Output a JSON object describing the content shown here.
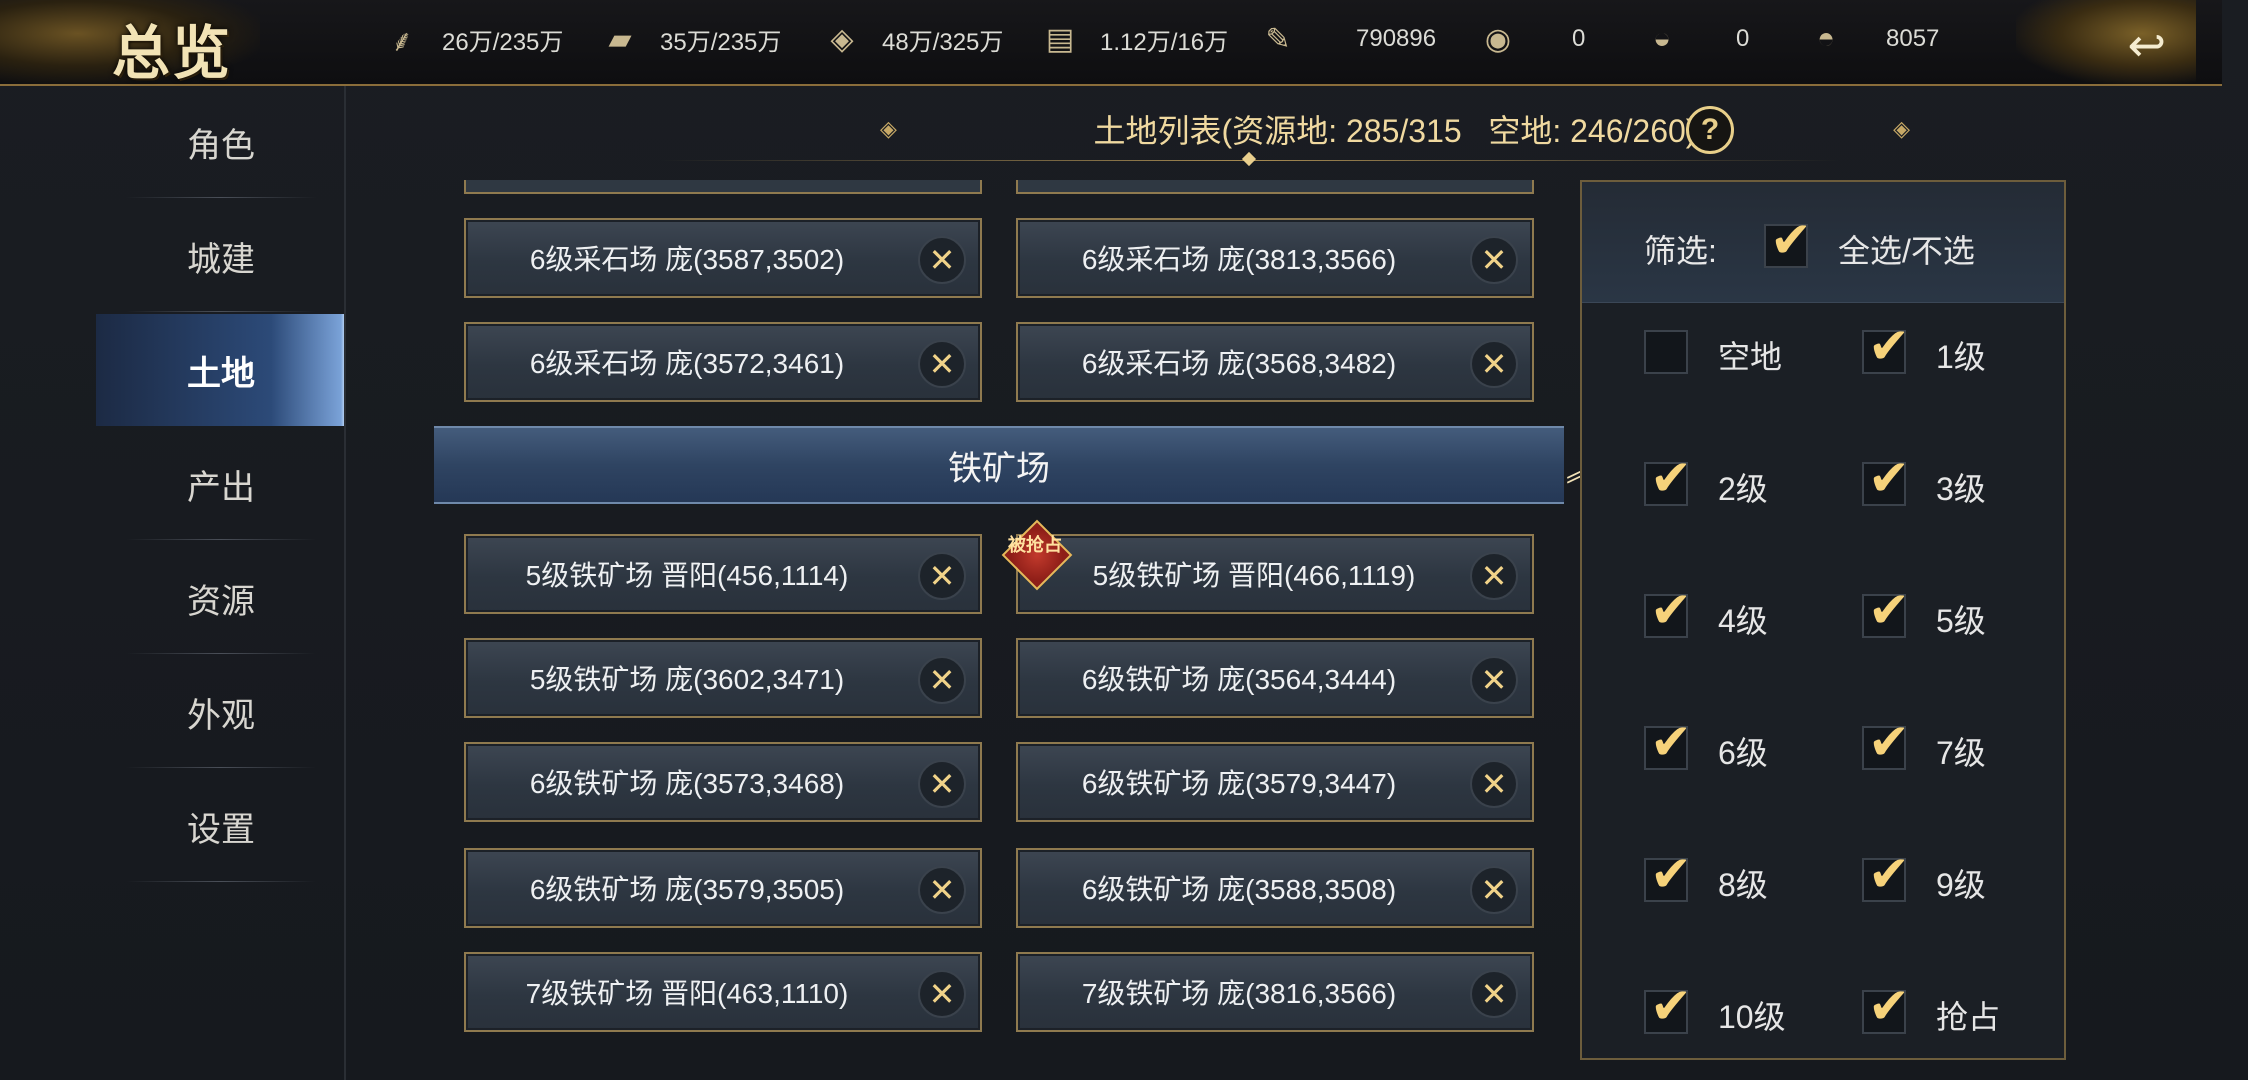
{
  "header": {
    "title": "总览",
    "resources": [
      {
        "icon": "wheat-icon",
        "glyph": "⸙",
        "value": "26万/235万"
      },
      {
        "icon": "wood-icon",
        "glyph": "▰",
        "value": "35万/235万"
      },
      {
        "icon": "stone-icon",
        "glyph": "◈",
        "value": "48万/325万"
      },
      {
        "icon": "iron-icon",
        "glyph": "▤",
        "value": "1.12万/16万"
      },
      {
        "icon": "scroll-icon",
        "glyph": "✎",
        "value": "790896"
      },
      {
        "icon": "coin-icon",
        "glyph": "◉",
        "value": "0"
      },
      {
        "icon": "gold-ingot-icon",
        "glyph": "◒",
        "value": "0"
      },
      {
        "icon": "silver-ingot-icon",
        "glyph": "◓",
        "value": "8057"
      }
    ]
  },
  "sidebar": {
    "items": [
      {
        "label": "角色"
      },
      {
        "label": "城建"
      },
      {
        "label": "土地",
        "active": true
      },
      {
        "label": "产出"
      },
      {
        "label": "资源"
      },
      {
        "label": "外观"
      },
      {
        "label": "设置"
      }
    ]
  },
  "land_list": {
    "title": "土地列表(资源地: 285/315   空地: 246/260)",
    "help": "?",
    "stone_rows": [
      [
        "6级采石场 庞(3587,3502)",
        "6级采石场 庞(3813,3566)"
      ],
      [
        "6级采石场 庞(3572,3461)",
        "6级采石场 庞(3568,3482)"
      ]
    ],
    "iron_section": "铁矿场",
    "iron_rows": [
      [
        "5级铁矿场 晋阳(456,1114)",
        "5级铁矿场 晋阳(466,1119)"
      ],
      [
        "5级铁矿场 庞(3602,3471)",
        "6级铁矿场 庞(3564,3444)"
      ],
      [
        "6级铁矿场 庞(3573,3468)",
        "6级铁矿场 庞(3579,3447)"
      ],
      [
        "6级铁矿场 庞(3579,3505)",
        "6级铁矿场 庞(3588,3508)"
      ],
      [
        "7级铁矿场 晋阳(463,1110)",
        "7级铁矿场 庞(3816,3566)"
      ]
    ],
    "seized_badge": "被抢占",
    "close_glyph": "✕"
  },
  "filter": {
    "label": "筛选:",
    "select_all": "全选/不选",
    "select_all_checked": true,
    "options": [
      {
        "label": "空地",
        "checked": false
      },
      {
        "label": "1级",
        "checked": true
      },
      {
        "label": "2级",
        "checked": true
      },
      {
        "label": "3级",
        "checked": true
      },
      {
        "label": "4级",
        "checked": true
      },
      {
        "label": "5级",
        "checked": true
      },
      {
        "label": "6级",
        "checked": true
      },
      {
        "label": "7级",
        "checked": true
      },
      {
        "label": "8级",
        "checked": true
      },
      {
        "label": "9级",
        "checked": true
      },
      {
        "label": "10级",
        "checked": true
      },
      {
        "label": "抢占",
        "checked": true
      }
    ]
  }
}
